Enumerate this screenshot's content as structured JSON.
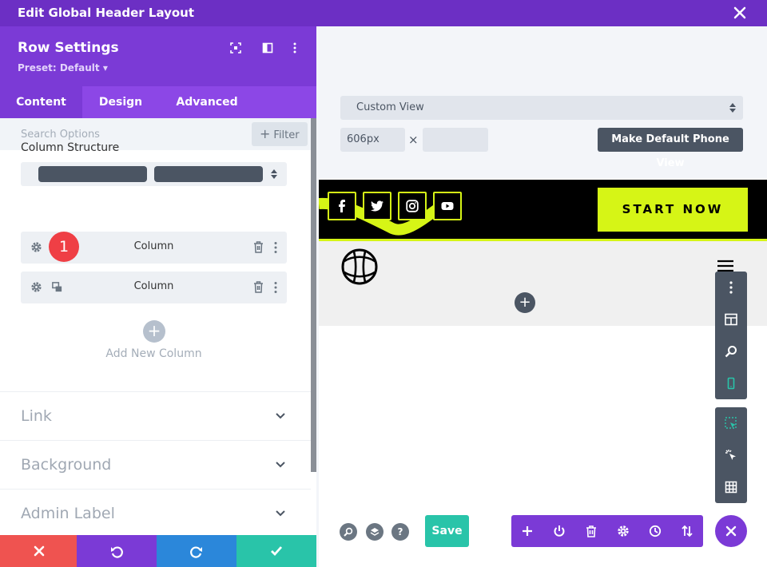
{
  "window": {
    "title": "Edit Global Header Layout"
  },
  "panel": {
    "title": "Row Settings",
    "preset": "Preset: Default ▾",
    "tabs": [
      {
        "label": "Content"
      },
      {
        "label": "Design"
      },
      {
        "label": "Advanced"
      }
    ],
    "search_placeholder": "Search Options",
    "filter_label": "Filter",
    "column_structure_label": "Column Structure",
    "columns": [
      {
        "label": "Column"
      },
      {
        "label": "Column"
      }
    ],
    "step_badge": "1",
    "add_column_label": "Add New Column",
    "sections": [
      {
        "label": "Link"
      },
      {
        "label": "Background"
      },
      {
        "label": "Admin Label"
      }
    ]
  },
  "preview": {
    "view_select": "Custom View",
    "width_value": "606px",
    "times_symbol": "×",
    "height_value": "",
    "default_phone_button": "Make Default Phone View",
    "cta_button": "START NOW",
    "save_label": "Save"
  },
  "colors": {
    "purple_dark": "#6c2fc4",
    "purple": "#7b3ad6",
    "neon": "#d6f516",
    "green": "#29c4a9",
    "red": "#ef5350",
    "blue": "#2b87da"
  }
}
